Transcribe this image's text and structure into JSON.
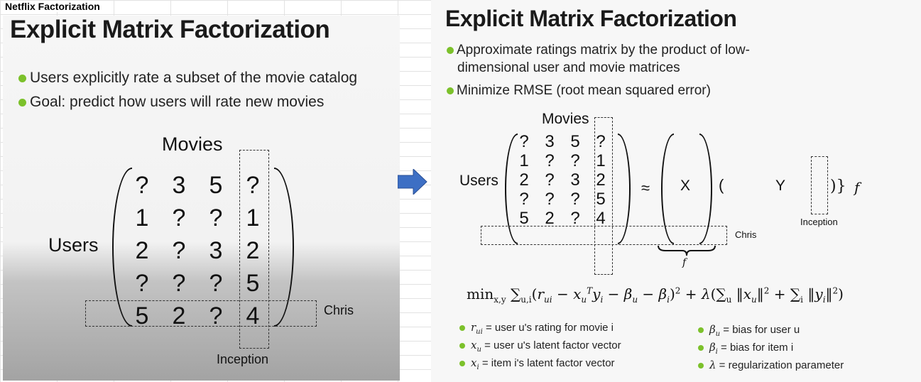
{
  "header_label": "Netflix Factorization",
  "left": {
    "title": "Explicit Matrix Factorization",
    "bullets": [
      "Users explicitly rate a subset of the movie catalog",
      "Goal: predict how users will rate new movies"
    ],
    "movies_label": "Movies",
    "users_label": "Users",
    "chris_label": "Chris",
    "inception_label": "Inception",
    "matrix": [
      [
        "?",
        "3",
        "5",
        "?"
      ],
      [
        "1",
        "?",
        "?",
        "1"
      ],
      [
        "2",
        "?",
        "3",
        "2"
      ],
      [
        "?",
        "?",
        "?",
        "5"
      ],
      [
        "5",
        "2",
        "?",
        "4"
      ]
    ]
  },
  "right": {
    "title": "Explicit Matrix Factorization",
    "bullets": [
      "Approximate ratings matrix by the product of low-",
      "dimensional user and movie matrices",
      "Minimize RMSE (root mean squared error)"
    ],
    "movies_label": "Movies",
    "users_label": "Users",
    "chris_label": "Chris",
    "inception_label": "Inception",
    "approx_symbol": "≈",
    "x_label": "X",
    "y_label": "Y",
    "f_label": "f",
    "matrix": [
      [
        "?",
        "3",
        "5",
        "?"
      ],
      [
        "1",
        "?",
        "?",
        "1"
      ],
      [
        "2",
        "?",
        "3",
        "2"
      ],
      [
        "?",
        "?",
        "?",
        "5"
      ],
      [
        "5",
        "2",
        "?",
        "4"
      ]
    ],
    "legend": [
      {
        "sym": "r",
        "sub": "ui",
        "text": "= user u's rating for movie i"
      },
      {
        "sym": "x",
        "sub": "u",
        "text": "= user u's latent factor vector"
      },
      {
        "sym": "x",
        "sub": "i",
        "text": "= item i's latent factor vector"
      },
      {
        "sym": "β",
        "sub": "u",
        "text": "= bias for user u"
      },
      {
        "sym": "β",
        "sub": "i",
        "text": "= bias for item i"
      },
      {
        "sym": "λ",
        "sub": "",
        "text": "= regularization parameter"
      }
    ]
  },
  "colors": {
    "bullet": "#7cc12b",
    "arrow": "#3d6fc4"
  }
}
